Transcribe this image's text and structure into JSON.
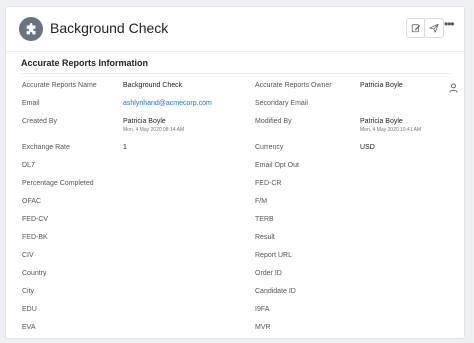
{
  "header": {
    "title": "Background Check"
  },
  "section": {
    "title": "Accurate Reports Information"
  },
  "rows": [
    {
      "left": {
        "label": "Accurate Reports Name",
        "value": "Background Check"
      },
      "right": {
        "label": "Accurate Reports Owner",
        "value": "Patricia Boyle"
      }
    },
    {
      "left": {
        "label": "Email",
        "value": "ashlynhand@acmecorp.com"
      },
      "right": {
        "label": "Secondary Email",
        "value": ""
      }
    },
    {
      "left": {
        "label": "Created By",
        "value": "Patricia Boyle",
        "sub": "Mon, 4 May 2020 08:14 AM"
      },
      "right": {
        "label": "Modified By",
        "value": "Patricia Boyle",
        "sub": "Mon, 4 May 2020 10:41 AM"
      }
    },
    {
      "left": {
        "label": "Exchange Rate",
        "value": "1"
      },
      "right": {
        "label": "Currency",
        "value": "USD"
      }
    },
    {
      "left": {
        "label": "DL7",
        "value": ""
      },
      "right": {
        "label": "Email Opt Out",
        "value": ""
      }
    },
    {
      "left": {
        "label": "Percentage Completed",
        "value": ""
      },
      "right": {
        "label": "FED-CR",
        "value": ""
      }
    },
    {
      "left": {
        "label": "OFAC",
        "value": ""
      },
      "right": {
        "label": "F/M",
        "value": ""
      }
    },
    {
      "left": {
        "label": "FED-CV",
        "value": ""
      },
      "right": {
        "label": "TERB",
        "value": ""
      }
    },
    {
      "left": {
        "label": "FED-BK",
        "value": ""
      },
      "right": {
        "label": "Result",
        "value": ""
      }
    },
    {
      "left": {
        "label": "CIV",
        "value": ""
      },
      "right": {
        "label": "Report URL",
        "value": ""
      }
    },
    {
      "left": {
        "label": "Country",
        "value": ""
      },
      "right": {
        "label": "Order ID",
        "value": ""
      }
    },
    {
      "left": {
        "label": "City",
        "value": ""
      },
      "right": {
        "label": "Candidate ID",
        "value": ""
      }
    },
    {
      "left": {
        "label": "EDU",
        "value": ""
      },
      "right": {
        "label": "I9FA",
        "value": ""
      }
    },
    {
      "left": {
        "label": "EVA",
        "value": ""
      },
      "right": {
        "label": "MVR",
        "value": ""
      }
    }
  ],
  "icons": {
    "record": "puzzle-icon",
    "edit": "edit-icon",
    "send": "send-icon",
    "more": "more-icon",
    "owner": "person-icon"
  }
}
